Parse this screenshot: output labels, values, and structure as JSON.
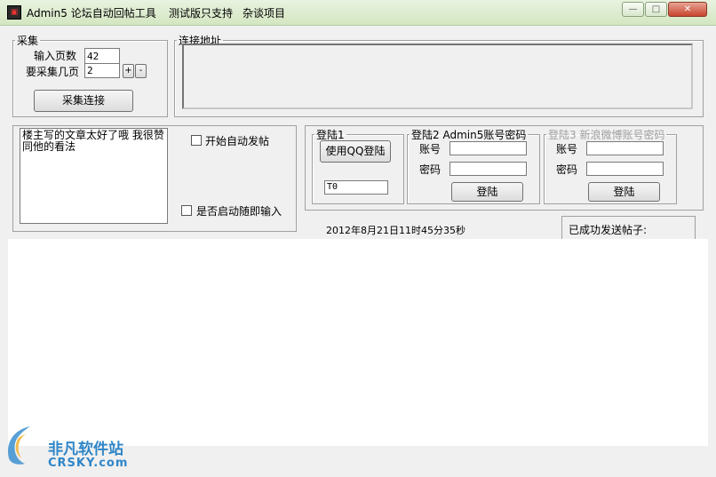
{
  "window": {
    "app_icon": "app-logo-icon",
    "title": "Admin5 论坛自动回帖工具",
    "menu": [
      "测试版只支持",
      "杂谈项目"
    ],
    "controls": {
      "minimize": "—",
      "maximize": "□",
      "close": "✕"
    }
  },
  "collect": {
    "legend": "采集",
    "pages_label": "输入页数",
    "pages_value": "42",
    "collect_pages_label": "要采集几页",
    "collect_pages_value": "2",
    "plus": "+",
    "minus": "-",
    "collect_button": "采集连接"
  },
  "links": {
    "legend": "连接地址"
  },
  "reply": {
    "content": "楼主写的文章太好了哦  我很赞同他的看法",
    "auto_post_label": "开始自动发帖",
    "auto_post_checked": false,
    "startup_input_label": "是否启动随即输入",
    "startup_input_checked": false
  },
  "login1": {
    "legend": "登陆1",
    "qq_button": "使用QQ登陆",
    "status_value": "T0"
  },
  "login2": {
    "legend": "登陆2 Admin5账号密码",
    "account_label": "账号",
    "password_label": "密码",
    "login_button": "登陆"
  },
  "login3": {
    "legend": "登陆3 新浪微博账号密码",
    "account_label": "账号",
    "password_label": "密码",
    "login_button": "登陆"
  },
  "status": {
    "timestamp": "2012年8月21日11时45分35秒",
    "sent_label": "已成功发送帖子:"
  },
  "watermark": {
    "logo_icon": "crsky-logo-icon",
    "name": "非凡软件站",
    "sub": "CRSKY.com"
  }
}
